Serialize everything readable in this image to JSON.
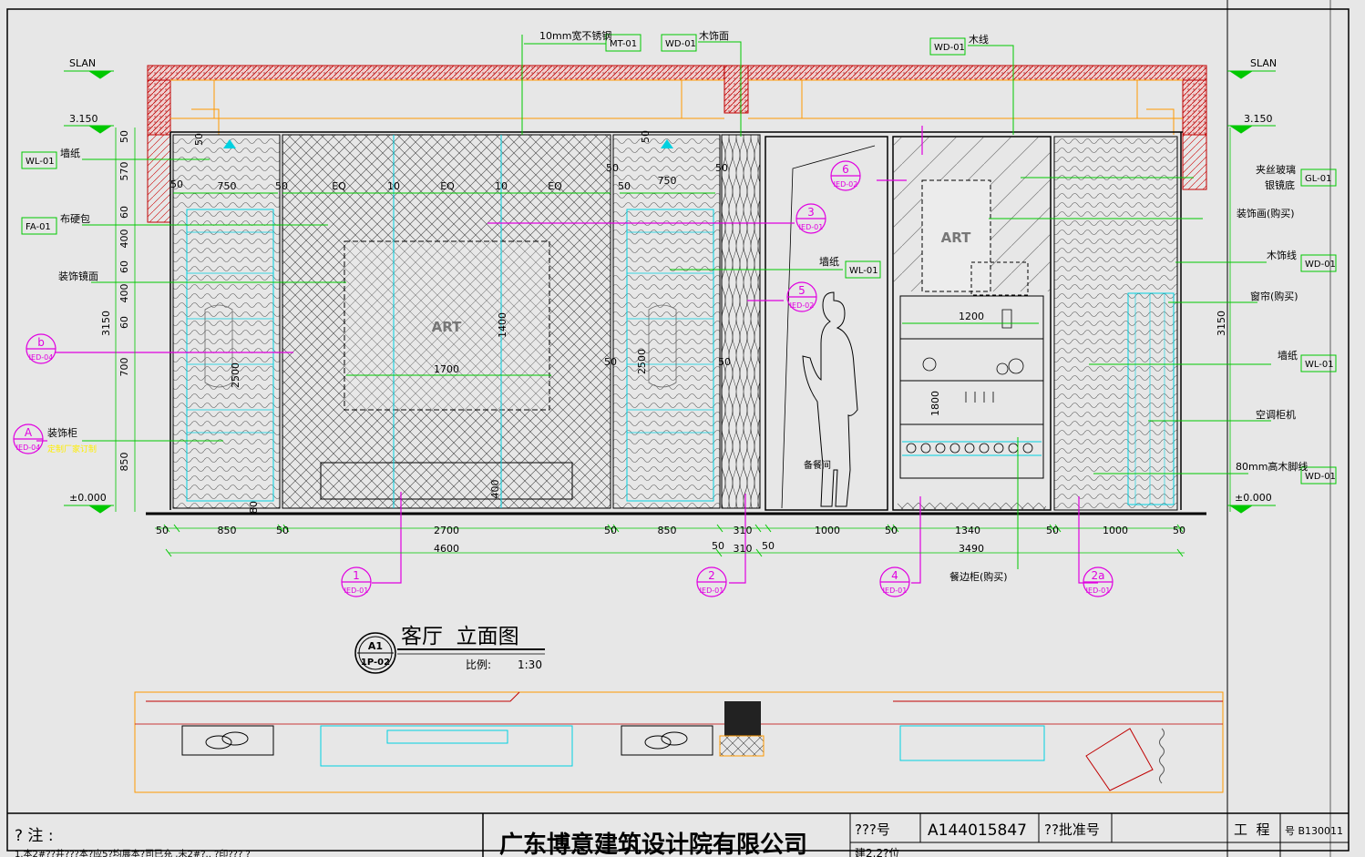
{
  "drawing": {
    "title": "客厅  立面图",
    "scale_label": "比例:",
    "scale_value": "1:30",
    "view_id": "A1",
    "sheet_id": "1P-02"
  },
  "levels": {
    "top_left": "SLAN",
    "top_right": "SLAN",
    "ceiling_left": "3.150",
    "ceiling_right": "3.150",
    "floor_left": "±0.000",
    "floor_right": "±0.000"
  },
  "callouts": {
    "top": [
      {
        "text": "10mm宽不锈钢",
        "code": "MT-01"
      },
      {
        "text": "木饰面",
        "code": "WD-01"
      },
      {
        "text": "木线",
        "code": "WD-01"
      }
    ],
    "left": [
      {
        "text": "墙纸",
        "code": "WL-01"
      },
      {
        "text": "布硬包",
        "code": "FA-01"
      },
      {
        "text": "装饰镜面",
        "code": ""
      },
      {
        "text": "装饰柜",
        "code": ""
      },
      {
        "text": "定制厂家订制",
        "code": ""
      }
    ],
    "right": [
      {
        "text": "夹丝玻璃",
        "code": "GL-01"
      },
      {
        "text": "银镜底",
        "code": ""
      },
      {
        "text": "装饰画(购买)",
        "code": ""
      },
      {
        "text": "木饰线",
        "code": "WD-01"
      },
      {
        "text": "窗帘(购买)",
        "code": ""
      },
      {
        "text": "墙纸",
        "code": "WL-01"
      },
      {
        "text": "空调柜机",
        "code": ""
      },
      {
        "text": "80mm高木脚线",
        "code": "WD-01"
      }
    ],
    "mid": [
      {
        "text": "墙纸",
        "code": "WL-01"
      },
      {
        "text": "餐边柜(购买)",
        "code": ""
      },
      {
        "text": "备餐间",
        "code": ""
      }
    ]
  },
  "section_marks": [
    {
      "num": "1",
      "ref": "IED-01"
    },
    {
      "num": "2",
      "ref": "IED-01"
    },
    {
      "num": "4",
      "ref": "IED-01"
    },
    {
      "num": "2a",
      "ref": "IED-01"
    },
    {
      "num": "3",
      "ref": "IED-01"
    },
    {
      "num": "5",
      "ref": "IED-02"
    },
    {
      "num": "6",
      "ref": "IED-02"
    },
    {
      "num": "b",
      "ref": "IED-04"
    },
    {
      "num": "A",
      "ref": "IED-04"
    }
  ],
  "dims": {
    "bottom_row": [
      "50",
      "850",
      "50",
      "2700",
      "50",
      "850",
      "310",
      "50",
      "1000",
      "50",
      "1340",
      "50",
      "1000",
      "50"
    ],
    "bottom_totals": [
      "4600",
      "50",
      "310",
      "50",
      "3490"
    ],
    "left_vertical": [
      "50",
      "570",
      "60",
      "400",
      "60",
      "400",
      "60",
      "700",
      "850"
    ],
    "left_total": "3150",
    "right_total": "3150",
    "inner": {
      "eq": [
        "EQ",
        "EQ",
        "EQ"
      ],
      "ten": [
        "10",
        "10"
      ],
      "fifty": [
        "50",
        "50",
        "50",
        "50",
        "50",
        "50",
        "50",
        "50",
        "50",
        "50"
      ],
      "w750": [
        "750",
        "750"
      ],
      "w1700": "1700",
      "h1400": "1400",
      "h2500": [
        "2500",
        "2500"
      ],
      "h400": "400",
      "w1200": "1200",
      "h1800": "1800",
      "h80": "80"
    },
    "art_labels": [
      "ART",
      "ART"
    ]
  },
  "title_block": {
    "notes_label": "? 注 :",
    "notes_line": "1.本2#??井???本?应5?均展本?司已充 ,未2#?.. ?印??? ?",
    "company": "广东博意建筑设计院有限公司",
    "field1_label": "???号",
    "field1_value": "A144015847",
    "field2_label": "??批准号",
    "field3_label": "工  程",
    "field3_value": "号 B130011",
    "cut_row": "建2.2?位"
  },
  "colors": {
    "background": "#e7e7e7",
    "line": "#000000",
    "green": "#00c800",
    "cyan": "#00d0e0",
    "magenta": "#e000e0",
    "red": "#d00000",
    "orange": "#ff9900",
    "yellow": "#ffee00"
  }
}
